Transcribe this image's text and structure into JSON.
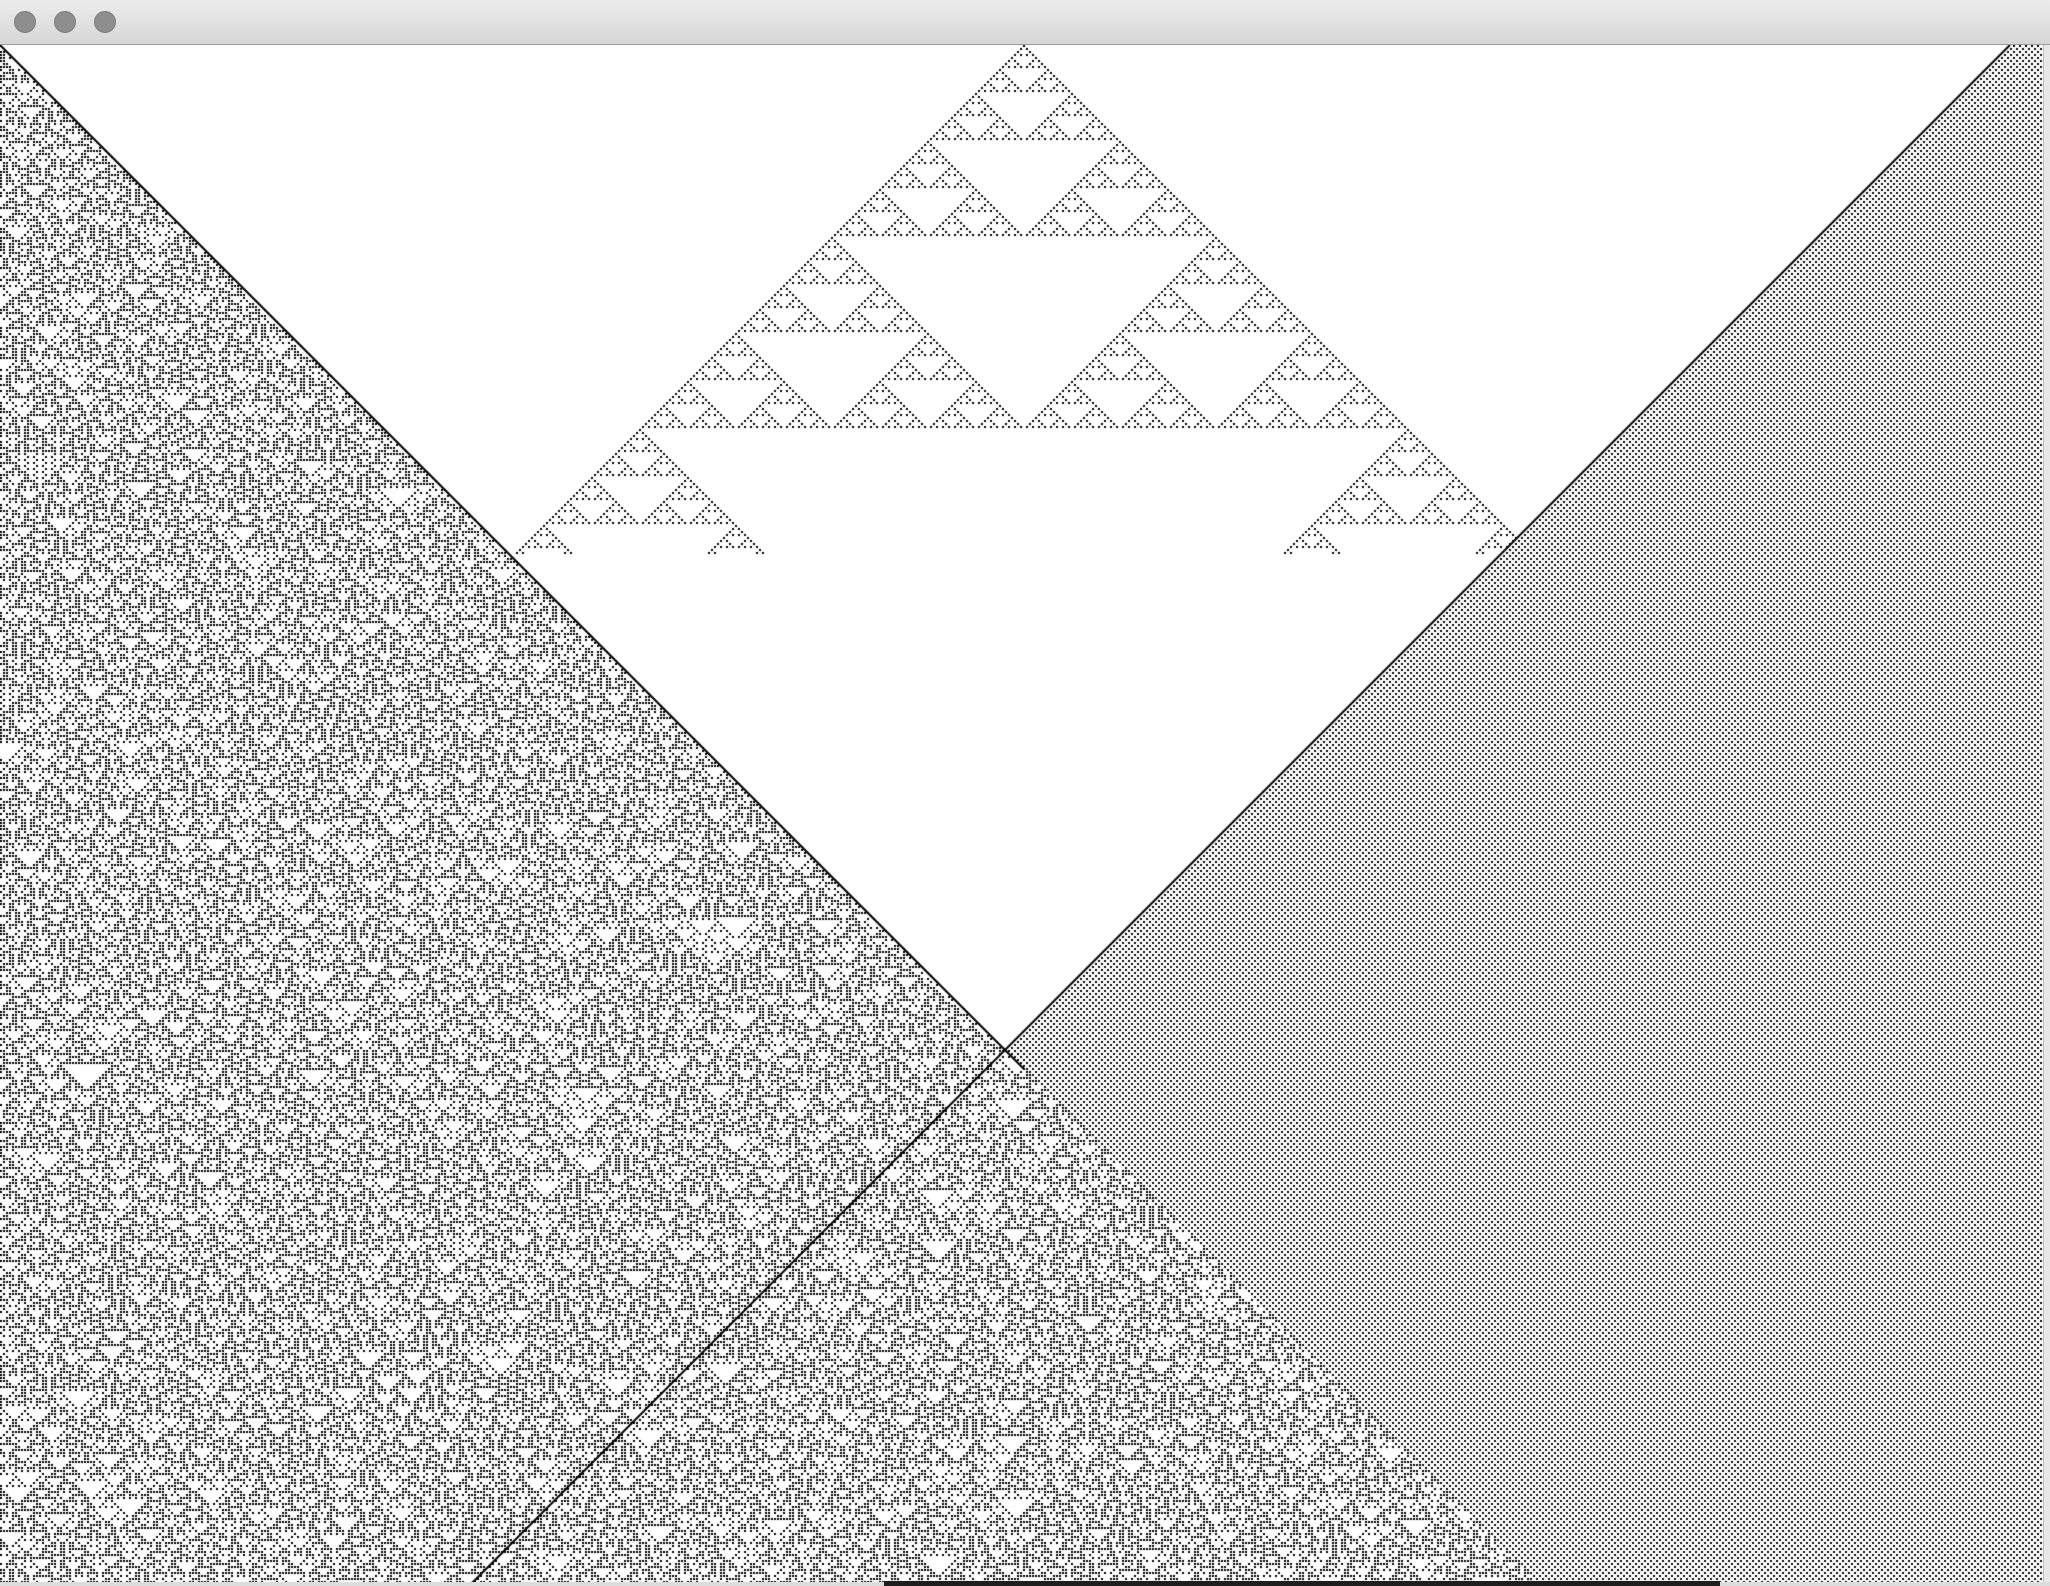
{
  "window": {
    "title": "",
    "controls": [
      {
        "name": "close-button"
      },
      {
        "name": "minimize-button"
      },
      {
        "name": "zoom-button"
      }
    ]
  },
  "automaton": {
    "description_visible": false,
    "cell_color": "#000000",
    "background_color": "#ffffff",
    "title_bar_color": "#dcdcdc",
    "button_color": "#8e8e8e"
  }
}
